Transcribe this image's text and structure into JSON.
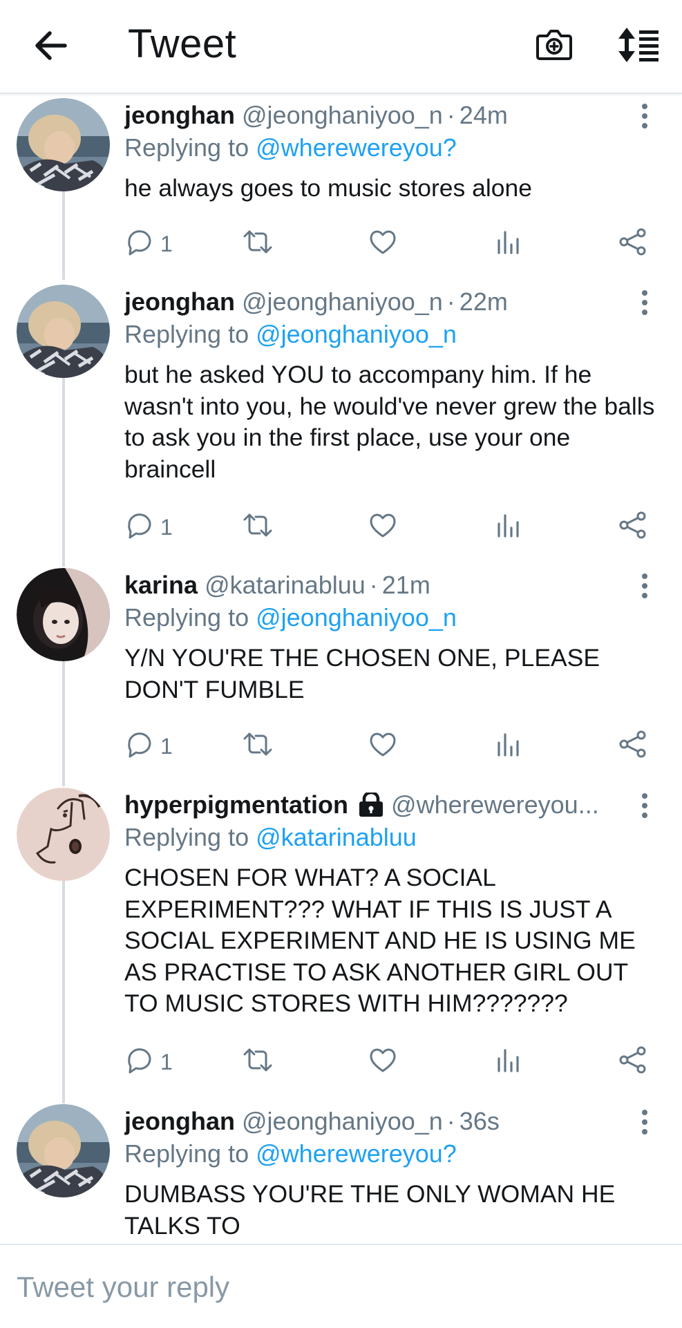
{
  "header": {
    "title": "Tweet",
    "icons": {
      "back": "arrow-left-icon",
      "camera": "camera-plus-icon",
      "sort": "sort-list-icon"
    }
  },
  "tweets": [
    {
      "name": "jeonghan",
      "handle": "@jeonghaniyoo_n",
      "separator": "·",
      "time": "24m",
      "replying_label": "Replying to",
      "replying_to": "@wherewereyou?",
      "text": "he always goes to music stores alone",
      "reply_count": "1",
      "avatar": "blonde-person-avatar"
    },
    {
      "name": "jeonghan",
      "handle": "@jeonghaniyoo_n",
      "separator": "·",
      "time": "22m",
      "replying_label": "Replying to",
      "replying_to": "@jeonghaniyoo_n",
      "text": "but he asked YOU to accompany him. If he wasn't into you, he would've never grew the balls to ask you in the first place, use your one braincell",
      "reply_count": "1",
      "avatar": "blonde-person-avatar"
    },
    {
      "name": "karina",
      "handle": "@katarinabluu",
      "separator": "·",
      "time": "21m",
      "replying_label": "Replying to",
      "replying_to": "@jeonghaniyoo_n",
      "text": "Y/N YOU'RE THE CHOSEN ONE, PLEASE DON'T FUMBLE",
      "reply_count": "1",
      "avatar": "dark-hair-person-avatar"
    },
    {
      "name": "hyperpigmentation",
      "handle": "@wherewereyou...",
      "replying_label": "Replying to",
      "replying_to": "@katarinabluu",
      "text": "CHOSEN FOR WHAT? A SOCIAL EXPERIMENT??? WHAT IF THIS IS JUST A SOCIAL EXPERIMENT AND HE IS USING ME AS PRACTISE TO ASK ANOTHER GIRL OUT TO MUSIC STORES WITH HIM???????",
      "reply_count": "1",
      "avatar": "doodle-face-avatar",
      "protected_icon": "lock-icon"
    },
    {
      "name": "jeonghan",
      "handle": "@jeonghaniyoo_n",
      "separator": "·",
      "time": "36s",
      "replying_label": "Replying to",
      "replying_to": "@wherewereyou?",
      "text": "DUMBASS YOU'RE THE ONLY WOMAN HE TALKS TO",
      "avatar": "blonde-person-avatar"
    }
  ],
  "reply_bar": {
    "placeholder": "Tweet your reply"
  },
  "colors": {
    "link": "#1da1f2",
    "secondary_text": "#657786",
    "primary_text": "#14171a",
    "divider": "#e1e8ed"
  }
}
